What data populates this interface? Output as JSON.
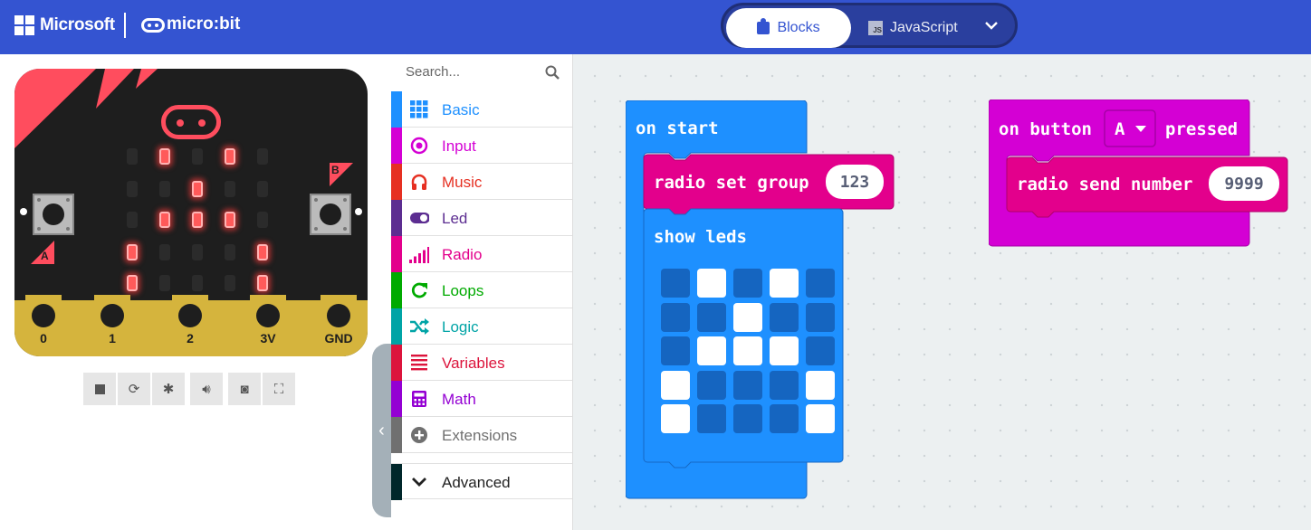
{
  "header": {
    "brand_ms": "Microsoft",
    "brand_mb": "micro:bit",
    "modes": [
      {
        "label": "Blocks",
        "active": true
      },
      {
        "label": "JavaScript",
        "active": false
      }
    ],
    "colors": {
      "bar": "#3454D1"
    }
  },
  "simulator": {
    "pins": [
      "0",
      "1",
      "2",
      "3V",
      "GND"
    ],
    "button_a": "A",
    "button_b": "B",
    "led_matrix": [
      [
        0,
        1,
        0,
        1,
        0
      ],
      [
        0,
        0,
        1,
        0,
        0
      ],
      [
        0,
        1,
        1,
        1,
        0
      ],
      [
        1,
        0,
        0,
        0,
        1
      ],
      [
        1,
        0,
        0,
        0,
        1
      ]
    ],
    "toolbar_icons": [
      "stop-icon",
      "restart-icon",
      "debug-icon",
      "mute-icon",
      "screenshot-icon",
      "fullscreen-icon"
    ]
  },
  "toolbox": {
    "search_placeholder": "Search...",
    "categories": [
      {
        "label": "Basic",
        "color": "#1E90FF",
        "icon": "grid-icon"
      },
      {
        "label": "Input",
        "color": "#D400D4",
        "icon": "radio-dot-icon"
      },
      {
        "label": "Music",
        "color": "#E63022",
        "icon": "headphones-icon"
      },
      {
        "label": "Led",
        "color": "#5C2D91",
        "icon": "toggle-icon"
      },
      {
        "label": "Radio",
        "color": "#E3008C",
        "icon": "signal-bars-icon"
      },
      {
        "label": "Loops",
        "color": "#00AA00",
        "icon": "loop-arrow-icon"
      },
      {
        "label": "Logic",
        "color": "#00A4A6",
        "icon": "shuffle-icon"
      },
      {
        "label": "Variables",
        "color": "#DC143C",
        "icon": "lines-icon"
      },
      {
        "label": "Math",
        "color": "#9400D3",
        "icon": "calculator-icon"
      },
      {
        "label": "Extensions",
        "color": "#707070",
        "icon": "plus-circle-icon"
      },
      {
        "label": "Advanced",
        "color": "#00272B",
        "icon": "chevron-down-icon"
      }
    ]
  },
  "workspace": {
    "on_start": {
      "label": "on start",
      "radio_set_group": "radio set group",
      "group_value": "123",
      "show_leds": "show leds",
      "leds": [
        [
          0,
          1,
          0,
          1,
          0
        ],
        [
          0,
          0,
          1,
          0,
          0
        ],
        [
          0,
          1,
          1,
          1,
          0
        ],
        [
          1,
          0,
          0,
          0,
          1
        ],
        [
          1,
          0,
          0,
          0,
          1
        ]
      ]
    },
    "on_button": {
      "label_on": "on button",
      "button": "A",
      "label_pressed": "pressed",
      "radio_send_number": "radio send number",
      "number_value": "9999"
    }
  }
}
